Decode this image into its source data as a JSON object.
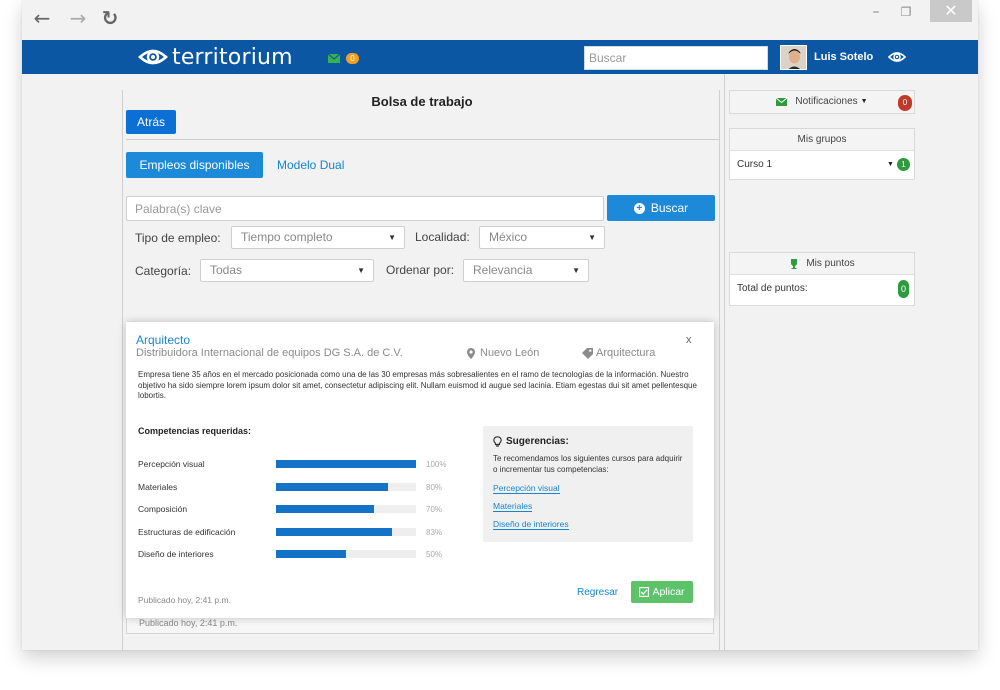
{
  "browser": {
    "back_icon": "←",
    "forward_icon": "→",
    "reload_icon": "↻",
    "minimize_icon": "–",
    "restore_icon": "❐",
    "close_icon": "✕"
  },
  "header": {
    "brand": "territorium",
    "messages_count": "0",
    "search_placeholder": "Buscar",
    "user_name": "Luis Sotelo",
    "accent_color": "#0b57a4"
  },
  "main": {
    "title": "Bolsa de trabajo",
    "back_label": "Atrás",
    "tabs": [
      {
        "label": "Empleos disponibles",
        "active": true
      },
      {
        "label": "Modelo Dual",
        "active": false
      }
    ],
    "keyword_placeholder": "Palabra(s) clave",
    "search_button": "Buscar",
    "filters": {
      "employment_type_label": "Tipo de empleo:",
      "employment_type_value": "Tiempo completo",
      "location_label": "Localidad:",
      "location_value": "México",
      "category_label": "Categoría:",
      "category_value": "Todas",
      "sort_label": "Ordenar por:",
      "sort_value": "Relevancia"
    },
    "background_card_date": "Publicado hoy, 2:41 p.m."
  },
  "job": {
    "title": "Arquitecto",
    "company": "Distribuidora Internacional de equipos DG S.A. de C.V.",
    "location": "Nuevo León",
    "category": "Arquitectura",
    "close_label": "x",
    "description": "Empresa tiene 35 años en el mercado posicionada como una de las 30 empresas más sobresalientes en el ramo de tecnologías de la información. Nuestro objetivo ha sido siempre lorem ipsum dolor sit amet, consectetur adipiscing elit. Nullam euismod id augue sed lacinia. Etiam egestas dui sit amet pellentesque lobortis.",
    "skills_title": "Competencias requeridas:",
    "skills": [
      {
        "name": "Percepción visual",
        "percent": 100,
        "label": "100%"
      },
      {
        "name": "Materiales",
        "percent": 80,
        "label": "80%"
      },
      {
        "name": "Composición",
        "percent": 70,
        "label": "70%"
      },
      {
        "name": "Estructuras de edificación",
        "percent": 83,
        "label": "83%"
      },
      {
        "name": "Diseño de interiores",
        "percent": 50,
        "label": "50%"
      }
    ],
    "suggestions": {
      "title": "Sugerencias:",
      "text": "Te recomendamos los siguientes cursos para adquirir o incrementar tus competencias:",
      "links": [
        "Percepción visual",
        "Materiales",
        "Diseño de interiores"
      ]
    },
    "published": "Publicado hoy, 2:41 p.m.",
    "back_button": "Regresar",
    "apply_button": "Aplicar",
    "bar_color": "#1573c7",
    "apply_color": "#5cc36b"
  },
  "sidebar": {
    "notifications_label": "Notificaciones",
    "notifications_count": "0",
    "groups_title": "Mis grupos",
    "group_name": "Curso 1",
    "group_count": "1",
    "points_title": "Mis puntos",
    "total_points_label": "Total de puntos:",
    "total_points_value": "0"
  }
}
